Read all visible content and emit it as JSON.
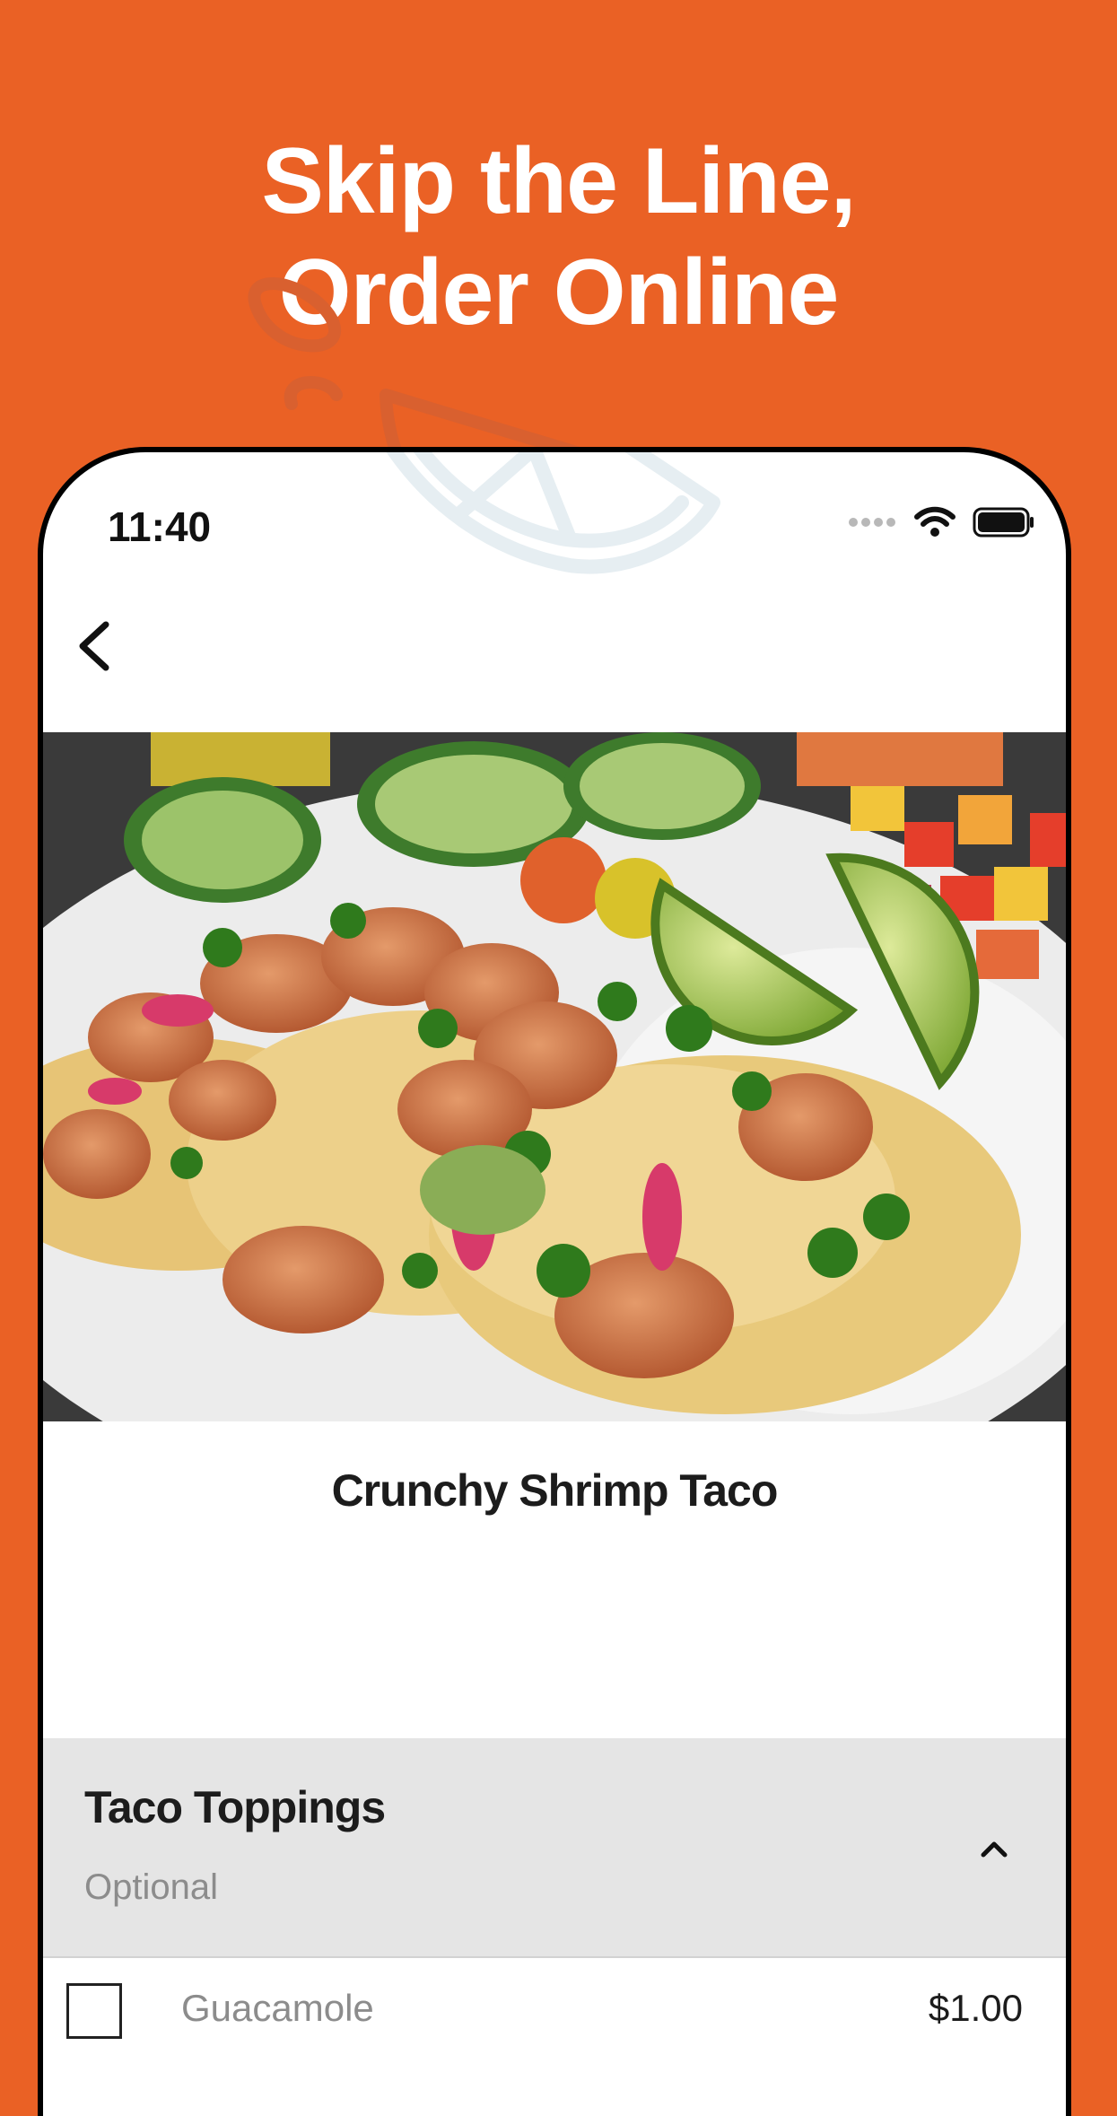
{
  "promo": {
    "line1": "Skip the Line,",
    "line2": "Order Online",
    "background_color": "#EA6125"
  },
  "status_bar": {
    "time": "11:40",
    "icons": [
      "signal-dots-icon",
      "wifi-icon",
      "battery-icon"
    ]
  },
  "nav": {
    "back_icon": "chevron-left-icon"
  },
  "item": {
    "image": "shrimp-taco-photo",
    "name": "Crunchy Shrimp Taco"
  },
  "modifier_group": {
    "title": "Taco Toppings",
    "subtitle": "Optional",
    "toggle_icon": "chevron-up-icon",
    "options": [
      {
        "label": "Guacamole",
        "price": "$1.00",
        "checked": false
      }
    ]
  }
}
